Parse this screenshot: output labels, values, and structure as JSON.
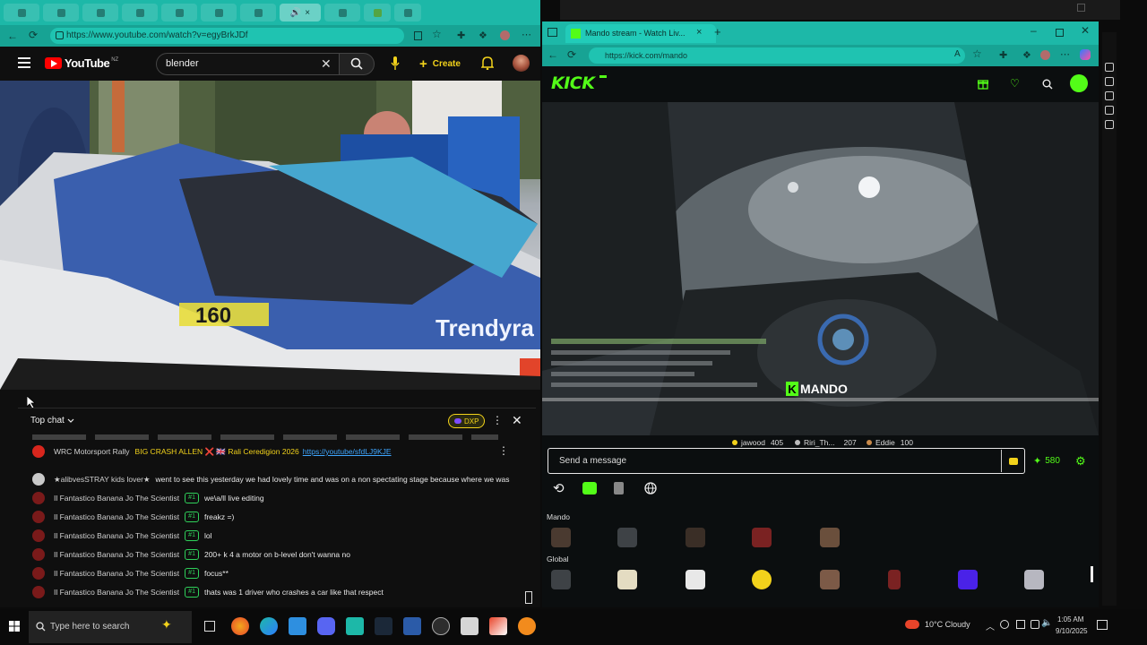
{
  "youtube": {
    "url": "https://www.youtube.com/watch?v=egyBrkJDf",
    "logo_text": "YouTube",
    "logo_region": "NZ",
    "search_value": "blender",
    "create_label": "Create",
    "chat": {
      "title": "Top chat",
      "xp_badge": "DXP",
      "messages": [
        {
          "author": "WRC Motorsport Rally",
          "badge": "",
          "message": "BIG CRASH ALLEN ❌ 🇬🇧 Rali Ceredigion 2026",
          "link": "https://youtube/sfdLJ9KJE"
        },
        {
          "author": "★alibvesSTRAY kids lover★",
          "badge": "",
          "message": "went to see this yesterday we had lovely time and was on a non spectating stage because where we was",
          "link": ""
        },
        {
          "author": "Il Fantastico Banana Jo The Scientist",
          "badge": "#1",
          "message": "we\\a/ll live editing",
          "link": ""
        },
        {
          "author": "Il Fantastico Banana Jo The Scientist",
          "badge": "#1",
          "message": "freakz =)",
          "link": ""
        },
        {
          "author": "Il Fantastico Banana Jo The Scientist",
          "badge": "#1",
          "message": "lol",
          "link": ""
        },
        {
          "author": "Il Fantastico Banana Jo The Scientist",
          "badge": "#1",
          "message": "200+ k 4 a motor on b-level don't wanna no",
          "link": ""
        },
        {
          "author": "Il Fantastico Banana Jo The Scientist",
          "badge": "#1",
          "message": "focus**",
          "link": ""
        },
        {
          "author": "Il Fantastico Banana Jo The Scientist",
          "badge": "#1",
          "message": "thats was 1 driver who crashes a car like that respect",
          "link": ""
        }
      ]
    },
    "video_overlay": {
      "car_number": "160",
      "car_text": "Trendyra"
    }
  },
  "kick": {
    "tab_title": "Mando stream - Watch Liv...",
    "url": "https://kick.com/mando",
    "logo_text": "KICK",
    "stream_tag": "MANDO",
    "viewers": [
      {
        "name": "jawood",
        "value": "405"
      },
      {
        "name": "Riri_Th...",
        "value": "207"
      },
      {
        "name": "Eddie",
        "value": "100"
      }
    ],
    "chat_placeholder": "Send a message",
    "points": "580",
    "emote_sections": [
      "Mando",
      "Global"
    ]
  },
  "taskbar": {
    "search_placeholder": "Type here to search",
    "weather": "10°C  Cloudy",
    "time": "1:05 AM",
    "date": "9/10/2025"
  },
  "colors": {
    "browser_teal": "#1db8a8",
    "kick_green": "#53fc18",
    "youtube_red": "#ff0000",
    "chat_link": "#3ea6ff"
  }
}
